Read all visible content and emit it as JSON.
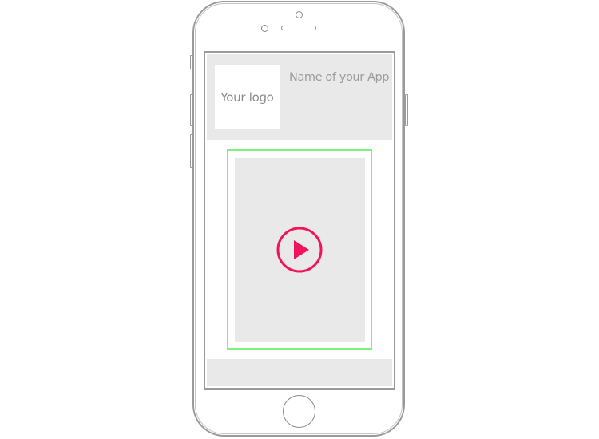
{
  "header": {
    "logo_label": "Your logo",
    "app_name": "Name of your App"
  },
  "video": {
    "play_icon": "play-circle-icon"
  },
  "colors": {
    "accent": "#f0145a",
    "frame_highlight": "#7ef07e",
    "placeholder_gray": "#e9e9e9",
    "outline_gray": "#9a9a9a"
  }
}
